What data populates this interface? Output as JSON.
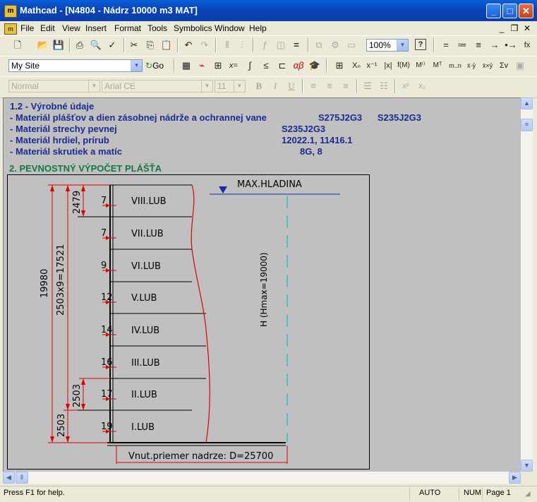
{
  "window": {
    "title": "Mathcad - [N4804 - Nádrz 10000 m3 MAT]",
    "app_icon_glyph": "m",
    "minimize_glyph": "_",
    "maximize_glyph": "□",
    "close_glyph": "✕"
  },
  "menu": {
    "items": [
      "File",
      "Edit",
      "View",
      "Insert",
      "Format",
      "Tools",
      "Symbolics",
      "Window",
      "Help"
    ],
    "mdi_minimize": "_",
    "mdi_restore": "❐",
    "mdi_close": "✕"
  },
  "toolbar1": {
    "zoom": "100%",
    "help_icon": "?"
  },
  "toolbar2": {
    "site": "My Site",
    "go_label": "Go"
  },
  "formatbar": {
    "style": "Normal",
    "font": "Arial CE",
    "size": "11",
    "bold": "B",
    "italic": "I",
    "underline": "U"
  },
  "document": {
    "lines": [
      "1.2 - Výrobné údaje",
      "- Materiál plášťov a dien zásobnej nádrže a ochrannej vane",
      "- Materiál strechy pevnej",
      "- Materiál hrdiel, prírub",
      "- Materiál skrutiek a matíc"
    ],
    "values": [
      "S275J2G3      S235J2G3",
      "S235J2G3",
      "12022.1, 11416.1",
      "8G, 8"
    ],
    "section_title": "2. PEVNOSTNÝ VÝPOČET PLÁŠŤA"
  },
  "drawing": {
    "max_level_label": "MAX.HLADINA",
    "height_label": "H (Hmax=19000)",
    "total_height": "19980",
    "course_sum": "2503x9=17521",
    "top_course_height": "2479",
    "course_height_1": "2503",
    "course_height_2": "2503",
    "diameter_label": "Vnut.priemer nadrze: D=25700",
    "courses": [
      {
        "name": "VIII.LUB",
        "thickness": "7"
      },
      {
        "name": "VII.LUB",
        "thickness": "7"
      },
      {
        "name": "VI.LUB",
        "thickness": "9"
      },
      {
        "name": "V.LUB",
        "thickness": "12"
      },
      {
        "name": "IV.LUB",
        "thickness": "14"
      },
      {
        "name": "III.LUB",
        "thickness": "16"
      },
      {
        "name": "II.LUB",
        "thickness": "17"
      },
      {
        "name": "I.LUB",
        "thickness": "19"
      }
    ]
  },
  "status": {
    "help": "Press F1 for help.",
    "mode": "AUTO",
    "num": "NUM",
    "page": "Page 1"
  }
}
